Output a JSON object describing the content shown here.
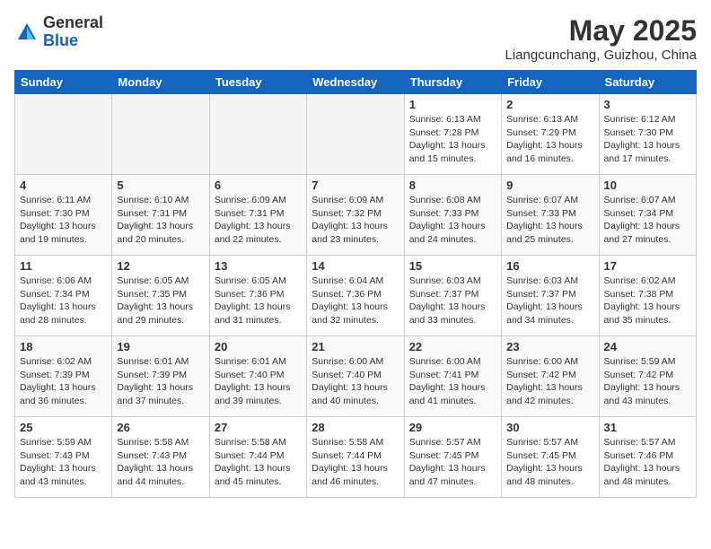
{
  "header": {
    "logo_general": "General",
    "logo_blue": "Blue",
    "month_year": "May 2025",
    "location": "Liangcunchang, Guizhou, China"
  },
  "days_of_week": [
    "Sunday",
    "Monday",
    "Tuesday",
    "Wednesday",
    "Thursday",
    "Friday",
    "Saturday"
  ],
  "weeks": [
    [
      {
        "num": "",
        "info": "",
        "empty": true
      },
      {
        "num": "",
        "info": "",
        "empty": true
      },
      {
        "num": "",
        "info": "",
        "empty": true
      },
      {
        "num": "",
        "info": "",
        "empty": true
      },
      {
        "num": "1",
        "info": "Sunrise: 6:13 AM\nSunset: 7:28 PM\nDaylight: 13 hours\nand 15 minutes.",
        "empty": false
      },
      {
        "num": "2",
        "info": "Sunrise: 6:13 AM\nSunset: 7:29 PM\nDaylight: 13 hours\nand 16 minutes.",
        "empty": false
      },
      {
        "num": "3",
        "info": "Sunrise: 6:12 AM\nSunset: 7:30 PM\nDaylight: 13 hours\nand 17 minutes.",
        "empty": false
      }
    ],
    [
      {
        "num": "4",
        "info": "Sunrise: 6:11 AM\nSunset: 7:30 PM\nDaylight: 13 hours\nand 19 minutes.",
        "empty": false
      },
      {
        "num": "5",
        "info": "Sunrise: 6:10 AM\nSunset: 7:31 PM\nDaylight: 13 hours\nand 20 minutes.",
        "empty": false
      },
      {
        "num": "6",
        "info": "Sunrise: 6:09 AM\nSunset: 7:31 PM\nDaylight: 13 hours\nand 22 minutes.",
        "empty": false
      },
      {
        "num": "7",
        "info": "Sunrise: 6:09 AM\nSunset: 7:32 PM\nDaylight: 13 hours\nand 23 minutes.",
        "empty": false
      },
      {
        "num": "8",
        "info": "Sunrise: 6:08 AM\nSunset: 7:33 PM\nDaylight: 13 hours\nand 24 minutes.",
        "empty": false
      },
      {
        "num": "9",
        "info": "Sunrise: 6:07 AM\nSunset: 7:33 PM\nDaylight: 13 hours\nand 25 minutes.",
        "empty": false
      },
      {
        "num": "10",
        "info": "Sunrise: 6:07 AM\nSunset: 7:34 PM\nDaylight: 13 hours\nand 27 minutes.",
        "empty": false
      }
    ],
    [
      {
        "num": "11",
        "info": "Sunrise: 6:06 AM\nSunset: 7:34 PM\nDaylight: 13 hours\nand 28 minutes.",
        "empty": false
      },
      {
        "num": "12",
        "info": "Sunrise: 6:05 AM\nSunset: 7:35 PM\nDaylight: 13 hours\nand 29 minutes.",
        "empty": false
      },
      {
        "num": "13",
        "info": "Sunrise: 6:05 AM\nSunset: 7:36 PM\nDaylight: 13 hours\nand 31 minutes.",
        "empty": false
      },
      {
        "num": "14",
        "info": "Sunrise: 6:04 AM\nSunset: 7:36 PM\nDaylight: 13 hours\nand 32 minutes.",
        "empty": false
      },
      {
        "num": "15",
        "info": "Sunrise: 6:03 AM\nSunset: 7:37 PM\nDaylight: 13 hours\nand 33 minutes.",
        "empty": false
      },
      {
        "num": "16",
        "info": "Sunrise: 6:03 AM\nSunset: 7:37 PM\nDaylight: 13 hours\nand 34 minutes.",
        "empty": false
      },
      {
        "num": "17",
        "info": "Sunrise: 6:02 AM\nSunset: 7:38 PM\nDaylight: 13 hours\nand 35 minutes.",
        "empty": false
      }
    ],
    [
      {
        "num": "18",
        "info": "Sunrise: 6:02 AM\nSunset: 7:39 PM\nDaylight: 13 hours\nand 36 minutes.",
        "empty": false
      },
      {
        "num": "19",
        "info": "Sunrise: 6:01 AM\nSunset: 7:39 PM\nDaylight: 13 hours\nand 37 minutes.",
        "empty": false
      },
      {
        "num": "20",
        "info": "Sunrise: 6:01 AM\nSunset: 7:40 PM\nDaylight: 13 hours\nand 39 minutes.",
        "empty": false
      },
      {
        "num": "21",
        "info": "Sunrise: 6:00 AM\nSunset: 7:40 PM\nDaylight: 13 hours\nand 40 minutes.",
        "empty": false
      },
      {
        "num": "22",
        "info": "Sunrise: 6:00 AM\nSunset: 7:41 PM\nDaylight: 13 hours\nand 41 minutes.",
        "empty": false
      },
      {
        "num": "23",
        "info": "Sunrise: 6:00 AM\nSunset: 7:42 PM\nDaylight: 13 hours\nand 42 minutes.",
        "empty": false
      },
      {
        "num": "24",
        "info": "Sunrise: 5:59 AM\nSunset: 7:42 PM\nDaylight: 13 hours\nand 43 minutes.",
        "empty": false
      }
    ],
    [
      {
        "num": "25",
        "info": "Sunrise: 5:59 AM\nSunset: 7:43 PM\nDaylight: 13 hours\nand 43 minutes.",
        "empty": false
      },
      {
        "num": "26",
        "info": "Sunrise: 5:58 AM\nSunset: 7:43 PM\nDaylight: 13 hours\nand 44 minutes.",
        "empty": false
      },
      {
        "num": "27",
        "info": "Sunrise: 5:58 AM\nSunset: 7:44 PM\nDaylight: 13 hours\nand 45 minutes.",
        "empty": false
      },
      {
        "num": "28",
        "info": "Sunrise: 5:58 AM\nSunset: 7:44 PM\nDaylight: 13 hours\nand 46 minutes.",
        "empty": false
      },
      {
        "num": "29",
        "info": "Sunrise: 5:57 AM\nSunset: 7:45 PM\nDaylight: 13 hours\nand 47 minutes.",
        "empty": false
      },
      {
        "num": "30",
        "info": "Sunrise: 5:57 AM\nSunset: 7:45 PM\nDaylight: 13 hours\nand 48 minutes.",
        "empty": false
      },
      {
        "num": "31",
        "info": "Sunrise: 5:57 AM\nSunset: 7:46 PM\nDaylight: 13 hours\nand 48 minutes.",
        "empty": false
      }
    ]
  ]
}
